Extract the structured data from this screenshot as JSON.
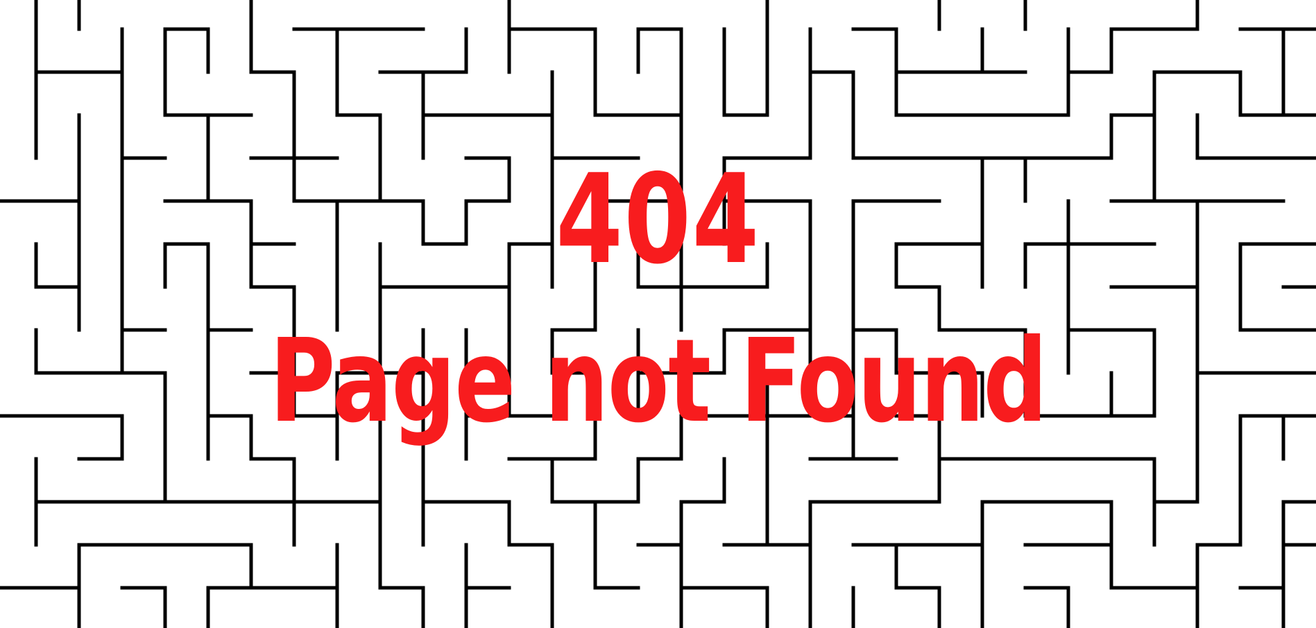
{
  "error": {
    "code": "404",
    "message": "Page not Found"
  },
  "colors": {
    "text": "#f81c1e",
    "maze_wall": "#000000",
    "background": "#ffffff"
  },
  "background": {
    "pattern": "maze"
  }
}
